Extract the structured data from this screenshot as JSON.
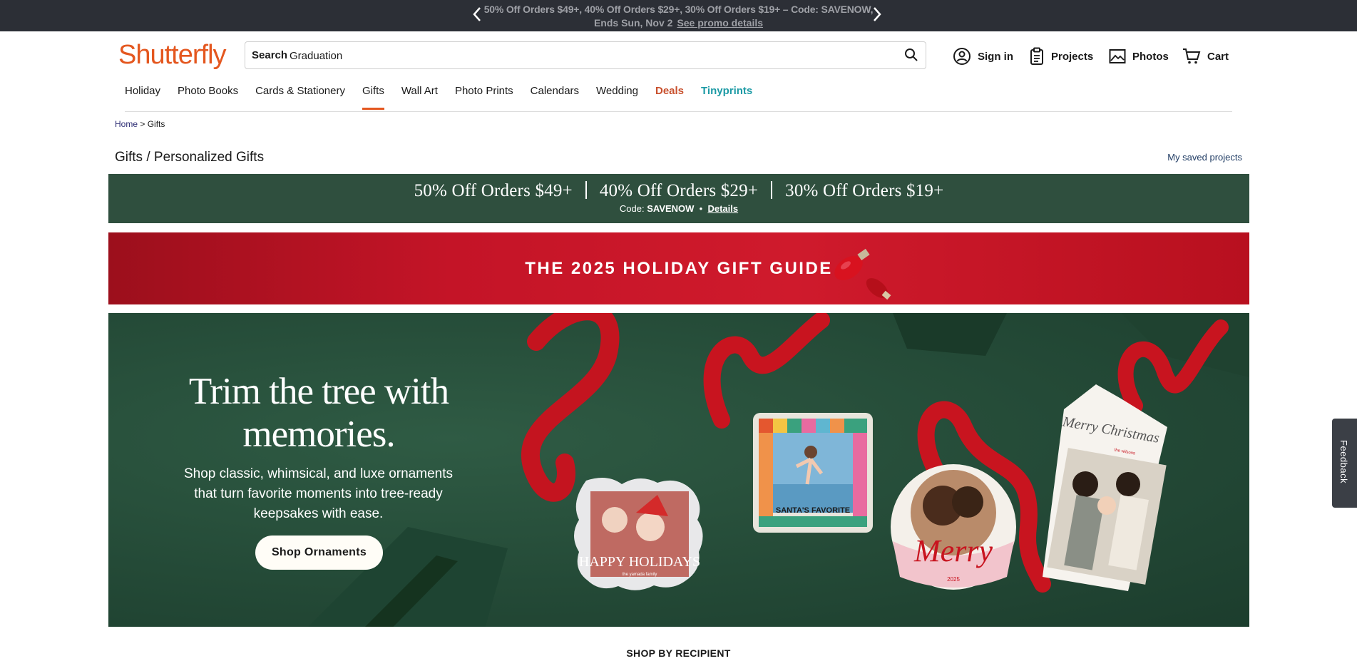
{
  "promo": {
    "line1": "50% Off Orders $49+, 40% Off Orders $29+, 30% Off Orders $19+ – Code: SAVENOW,",
    "line2": "Ends Sun, Nov 2",
    "details_link": "See promo details",
    "prev_icon": "chevron-left-icon",
    "next_icon": "chevron-right-icon"
  },
  "header": {
    "logo": "Shutterfly",
    "search_label": "Search",
    "search_value": "Graduation",
    "sign_in": "Sign in",
    "projects": "Projects",
    "photos": "Photos",
    "cart": "Cart"
  },
  "nav": {
    "items": [
      "Holiday",
      "Photo Books",
      "Cards & Stationery",
      "Gifts",
      "Wall Art",
      "Photo Prints",
      "Calendars",
      "Wedding",
      "Deals",
      "Tinyprints"
    ],
    "active": "Gifts"
  },
  "breadcrumb": {
    "home": "Home",
    "sep": ">",
    "current": "Gifts"
  },
  "page_title": "Gifts / Personalized Gifts",
  "saved_projects": "My saved projects",
  "green_banner": {
    "offer1": "50% Off Orders $49+",
    "offer2": "40% Off Orders $29+",
    "offer3": "30% Off Orders $19+",
    "code_label": "Code:",
    "code": "SAVENOW",
    "bullet": "•",
    "details": "Details"
  },
  "red_banner": {
    "title": "THE 2025 HOLIDAY GIFT GUIDE"
  },
  "hero": {
    "title": "Trim the tree with memories.",
    "subtitle": "Shop classic, whimsical, and luxe ornaments that turn favorite moments into tree-ready keepsakes with ease.",
    "button": "Shop Ornaments",
    "ornament_scalloped_text": "HAPPY HOLIDAYS",
    "ornament_scalloped_small": "the yamada family",
    "ornament_square_text": "SANTA'S FAVORITE",
    "ornament_round_text": "Merry",
    "ornament_round_year": "2025",
    "ornament_tag_text": "Merry Christmas",
    "ornament_tag_small": "the wilsons"
  },
  "feedback": "Feedback",
  "shop_by": "SHOP BY RECIPIENT",
  "colors": {
    "brand_orange": "#e4571f",
    "promo_bar": "#2c2f36",
    "green_banner": "#2f4f3e",
    "red_banner": "#c41427",
    "hero_green": "#244a37",
    "tinyprints": "#1c9aa5"
  }
}
